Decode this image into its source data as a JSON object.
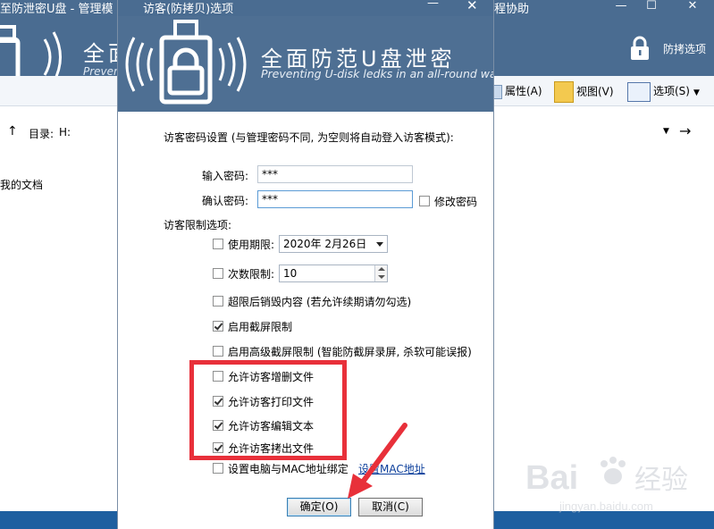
{
  "background": {
    "title_left": "至防泄密U盘 - 管理模",
    "title_right": "程协助",
    "banner_title": "全面",
    "banner_sub": "Preven",
    "protect_options": "防拷选项",
    "toolbar": {
      "attributes": "属性(A)",
      "view": "视图(V)",
      "options": "选项(S)"
    },
    "directory_label": "目录:",
    "directory_value": "H:",
    "left_doc": "我的文档"
  },
  "dialog": {
    "title": "访客(防拷贝)选项",
    "banner_title": "全面防范U盘泄密",
    "banner_sub": "Preventing U-disk ledks in an all-round way",
    "heading": "访客密码设置 (与管理密码不同, 为空则将自动登入访客模式):",
    "password_label": "输入密码:",
    "password_value": "***",
    "confirm_label": "确认密码:",
    "confirm_value": "***",
    "change_password": {
      "label": "修改密码",
      "checked": false
    },
    "restrictions_heading": "访客限制选项:",
    "options": [
      {
        "label": "使用期限:",
        "checked": false
      },
      {
        "label": "次数限制:",
        "checked": false
      },
      {
        "label": "超限后销毁内容 (若允许续期请勿勾选)",
        "checked": false
      },
      {
        "label": "启用截屏限制",
        "checked": true
      },
      {
        "label": "启用高级截屏限制 (智能防截屏录屏, 杀软可能误报)",
        "checked": false
      },
      {
        "label": "允许访客增删文件",
        "checked": false
      },
      {
        "label": "允许访客打印文件",
        "checked": true
      },
      {
        "label": "允许访客编辑文本",
        "checked": true
      },
      {
        "label": "允许访客拷出文件",
        "checked": true
      },
      {
        "label": "设置电脑与MAC地址绑定",
        "checked": false
      }
    ],
    "date_value": "2020年  2月26日",
    "count_value": "10",
    "mac_link": "设置MAC地址",
    "ok_button": "确定(O)",
    "cancel_button": "取消(C)"
  },
  "watermark": {
    "brand": "Bai",
    "brand_cn": "经验",
    "url": "jingyan.baidu.com"
  },
  "colors": {
    "title_blue": "#4a6c91",
    "highlight_red": "#e8303a",
    "link_blue": "#0b3e9b"
  }
}
